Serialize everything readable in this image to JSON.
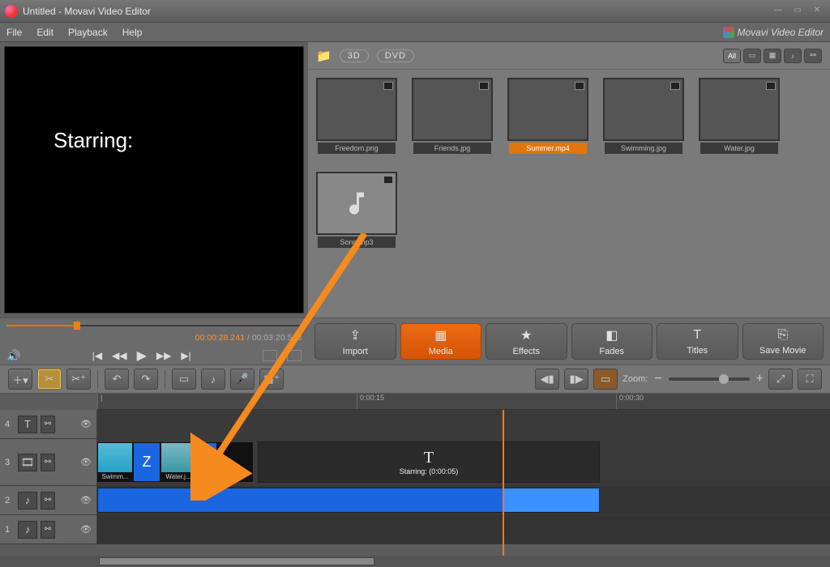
{
  "title": "Untitled - Movavi Video Editor",
  "brand": "Movavi Video Editor",
  "menu": {
    "file": "File",
    "edit": "Edit",
    "playback": "Playback",
    "help": "Help"
  },
  "preview": {
    "text": "Starring:"
  },
  "media_top": {
    "threeD": "3D",
    "dvd": "DVD",
    "all": "All"
  },
  "thumbs": [
    {
      "label": "Freedom.png"
    },
    {
      "label": "Friends.jpg"
    },
    {
      "label": "Summer.mp4"
    },
    {
      "label": "Swimming.jpg"
    },
    {
      "label": "Water.jpg"
    },
    {
      "label": "Song.mp3"
    }
  ],
  "time": {
    "current": "00:00:28.241",
    "total": "00:03:20.568"
  },
  "modes": {
    "import": "Import",
    "media": "Media",
    "effects": "Effects",
    "fades": "Fades",
    "titles": "Titles",
    "save": "Save Movie"
  },
  "zoom_label": "Zoom:",
  "ruler": {
    "t1": "0:00:15",
    "t2": "0:00:30"
  },
  "tracks": {
    "n4": "4",
    "n3": "3",
    "n2": "2",
    "n1": "1"
  },
  "tclips": {
    "swim": "Swimm...",
    "water": "Water.j...",
    "text_big": "T",
    "text_sub": "Starring: (0:00:05)"
  }
}
